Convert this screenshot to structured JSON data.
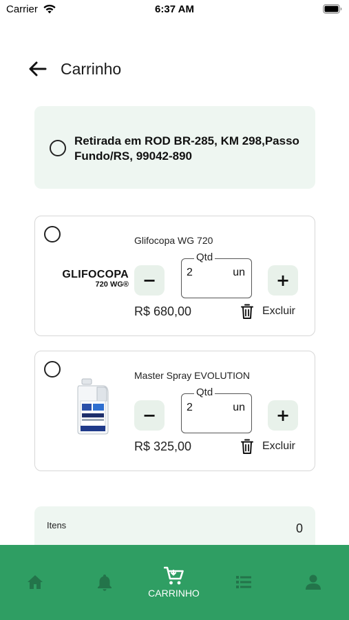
{
  "status_bar": {
    "carrier": "Carrier",
    "time": "6:37 AM"
  },
  "header": {
    "title": "Carrinho"
  },
  "pickup": {
    "text": "Retirada em ROD BR-285, KM 298,Passo Fundo/RS, 99042-890"
  },
  "products": [
    {
      "name": "Glifocopa WG 720",
      "logo_line1": "GLIFOCOPA",
      "logo_line2": "720 WG®",
      "qty_label": "Qtd",
      "qty_value": "2",
      "qty_unit": "un",
      "minus_label": "−",
      "plus_label": "+",
      "price": "R$ 680,00",
      "delete_label": "Excluir"
    },
    {
      "name": "Master Spray EVOLUTION",
      "qty_label": "Qtd",
      "qty_value": "2",
      "qty_unit": "un",
      "minus_label": "−",
      "plus_label": "+",
      "price": "R$ 325,00",
      "delete_label": "Excluir"
    }
  ],
  "summary": {
    "items_label": "Itens",
    "items_value": "0"
  },
  "bottom_nav": {
    "items": [
      {
        "icon": "home-icon",
        "label": ""
      },
      {
        "icon": "bell-icon",
        "label": ""
      },
      {
        "icon": "cart-icon",
        "label": "CARRINHO"
      },
      {
        "icon": "list-icon",
        "label": ""
      },
      {
        "icon": "user-icon",
        "label": ""
      }
    ],
    "active_index": 2
  },
  "colors": {
    "nav_background": "#2f9e63",
    "nav_icon_inactive": "#23744a",
    "card_tint": "#eef6f1",
    "button_tint": "#e8f1ea"
  }
}
